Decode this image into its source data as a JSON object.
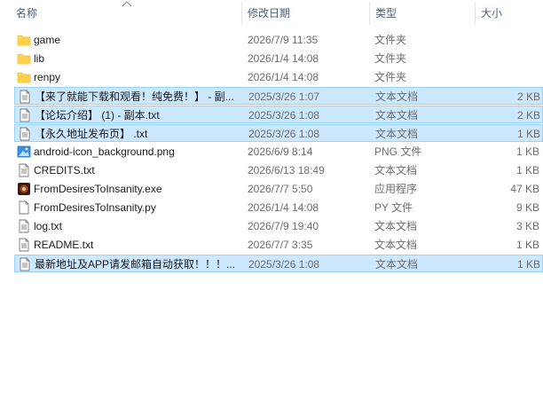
{
  "columns": {
    "name": "名称",
    "date": "修改日期",
    "type": "类型",
    "size": "大小"
  },
  "files": [
    {
      "icon": "folder-icon",
      "name": "game",
      "date": "2026/7/9 11:35",
      "type": "文件夹",
      "size": "",
      "selected": false
    },
    {
      "icon": "folder-icon",
      "name": "lib",
      "date": "2026/1/4 14:08",
      "type": "文件夹",
      "size": "",
      "selected": false
    },
    {
      "icon": "folder-icon",
      "name": "renpy",
      "date": "2026/1/4 14:08",
      "type": "文件夹",
      "size": "",
      "selected": false
    },
    {
      "icon": "text-file-icon",
      "name": "【来了就能下载和观看！纯免费！】 - 副...",
      "date": "2025/3/26 1:07",
      "type": "文本文档",
      "size": "2 KB",
      "selected": true
    },
    {
      "icon": "text-file-icon",
      "name": "【论坛介绍】 (1) - 副本.txt",
      "date": "2025/3/26 1:08",
      "type": "文本文档",
      "size": "2 KB",
      "selected": true
    },
    {
      "icon": "text-file-icon",
      "name": "【永久地址发布页】 .txt",
      "date": "2025/3/26 1:08",
      "type": "文本文档",
      "size": "1 KB",
      "selected": true
    },
    {
      "icon": "image-file-icon",
      "name": "android-icon_background.png",
      "date": "2026/6/9 8:14",
      "type": "PNG 文件",
      "size": "1 KB",
      "selected": false
    },
    {
      "icon": "text-file-icon",
      "name": "CREDITS.txt",
      "date": "2026/6/13 18:49",
      "type": "文本文档",
      "size": "1 KB",
      "selected": false
    },
    {
      "icon": "app-exe-icon",
      "name": "FromDesiresToInsanity.exe",
      "date": "2026/7/7 5:50",
      "type": "应用程序",
      "size": "47 KB",
      "selected": false
    },
    {
      "icon": "blank-file-icon",
      "name": "FromDesiresToInsanity.py",
      "date": "2026/1/4 14:08",
      "type": "PY 文件",
      "size": "9 KB",
      "selected": false
    },
    {
      "icon": "text-file-icon",
      "name": "log.txt",
      "date": "2026/7/9 19:40",
      "type": "文本文档",
      "size": "3 KB",
      "selected": false
    },
    {
      "icon": "text-file-icon",
      "name": "README.txt",
      "date": "2026/7/7 3:35",
      "type": "文本文档",
      "size": "1 KB",
      "selected": false
    },
    {
      "icon": "text-file-icon",
      "name": "最新地址及APP请发邮箱自动获取！！！...",
      "date": "2025/3/26 1:08",
      "type": "文本文档",
      "size": "1 KB",
      "selected": true
    }
  ]
}
